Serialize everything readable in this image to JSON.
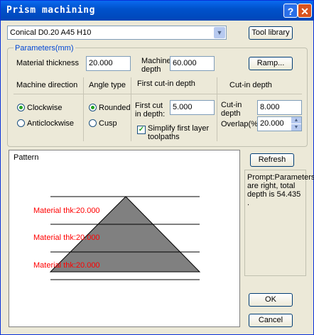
{
  "window": {
    "title": "Prism machining",
    "help_icon": "?",
    "close_icon": "✕"
  },
  "tool": {
    "selected": "Conical D0.20 A45 H10",
    "library_button": "Tool library"
  },
  "parameters": {
    "legend": "Parameters(mm)",
    "material_thickness_label": "Material thickness",
    "material_thickness": "20.000",
    "machine_depth_label": "Machine depth",
    "machine_depth": "60.000",
    "ramp_button": "Ramp..."
  },
  "machine_direction": {
    "header": "Machine direction",
    "options": [
      "Clockwise",
      "Anticlockwise"
    ],
    "selected": "Clockwise"
  },
  "angle_type": {
    "header": "Angle type",
    "options": [
      "Rounded",
      "Cusp"
    ],
    "selected": "Rounded"
  },
  "first_cutin": {
    "header": "First cut-in depth",
    "label": "First cut in depth:",
    "value": "5.000",
    "simplify_label": "Simplify first layer toolpaths",
    "simplify_checked": true
  },
  "cutin": {
    "header": "Cut-in depth",
    "depth_label": "Cut-in depth",
    "depth": "8.000",
    "overlap_label": "Overlap(%)",
    "overlap": "20.000"
  },
  "pattern": {
    "label": "Pattern",
    "layers": [
      "Material thk:20.000",
      "Material thk:20.000",
      "Material thk:20.000"
    ],
    "prism_color": "#808080",
    "layer_text_color": "#ff0000"
  },
  "prompt": "Prompt:Parameters are right, total depth is 54.435 .",
  "buttons": {
    "refresh": "Refresh",
    "ok": "OK",
    "cancel": "Cancel"
  }
}
